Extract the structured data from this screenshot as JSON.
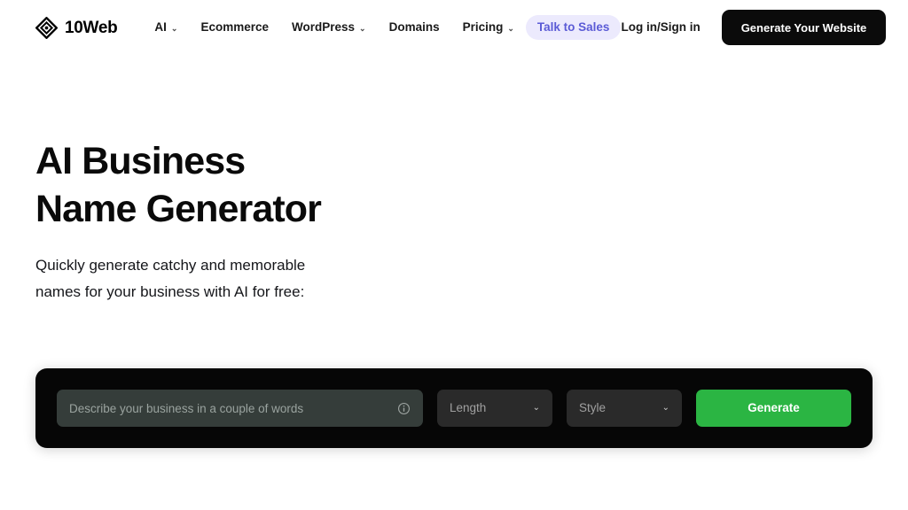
{
  "header": {
    "brand": {
      "name": "10Web",
      "logo_icon": "diamond-logo-icon"
    },
    "nav": [
      {
        "label": "AI",
        "has_dropdown": true,
        "accent": false
      },
      {
        "label": "Ecommerce",
        "has_dropdown": false,
        "accent": false
      },
      {
        "label": "WordPress",
        "has_dropdown": true,
        "accent": false
      },
      {
        "label": "Domains",
        "has_dropdown": false,
        "accent": false
      },
      {
        "label": "Pricing",
        "has_dropdown": true,
        "accent": false
      },
      {
        "label": "Talk to Sales",
        "has_dropdown": false,
        "accent": true
      }
    ],
    "caret_glyph": "⌄",
    "login_label": "Log in/Sign in",
    "cta_label": "Generate Your Website",
    "accent_text_color": "#5b5bd6",
    "accent_bg_color": "#eceafd",
    "cta_bg_color": "#0b0b0b"
  },
  "hero": {
    "title_line1": "AI Business",
    "title_line2": "Name Generator",
    "subtitle_line1": "Quickly generate catchy and memorable",
    "subtitle_line2": "names for your business with AI for free:"
  },
  "generator": {
    "panel_bg_color": "#060606",
    "description_placeholder": "Describe your business in a couple of words",
    "description_value": "",
    "info_icon": "info-circle-icon",
    "length_label": "Length",
    "style_label": "Style",
    "caret_glyph": "⌄",
    "generate_label": "Generate",
    "generate_bg_color": "#2bb543",
    "input_bg_color": "#353d3a",
    "select_bg_color": "#2a2a2a"
  }
}
